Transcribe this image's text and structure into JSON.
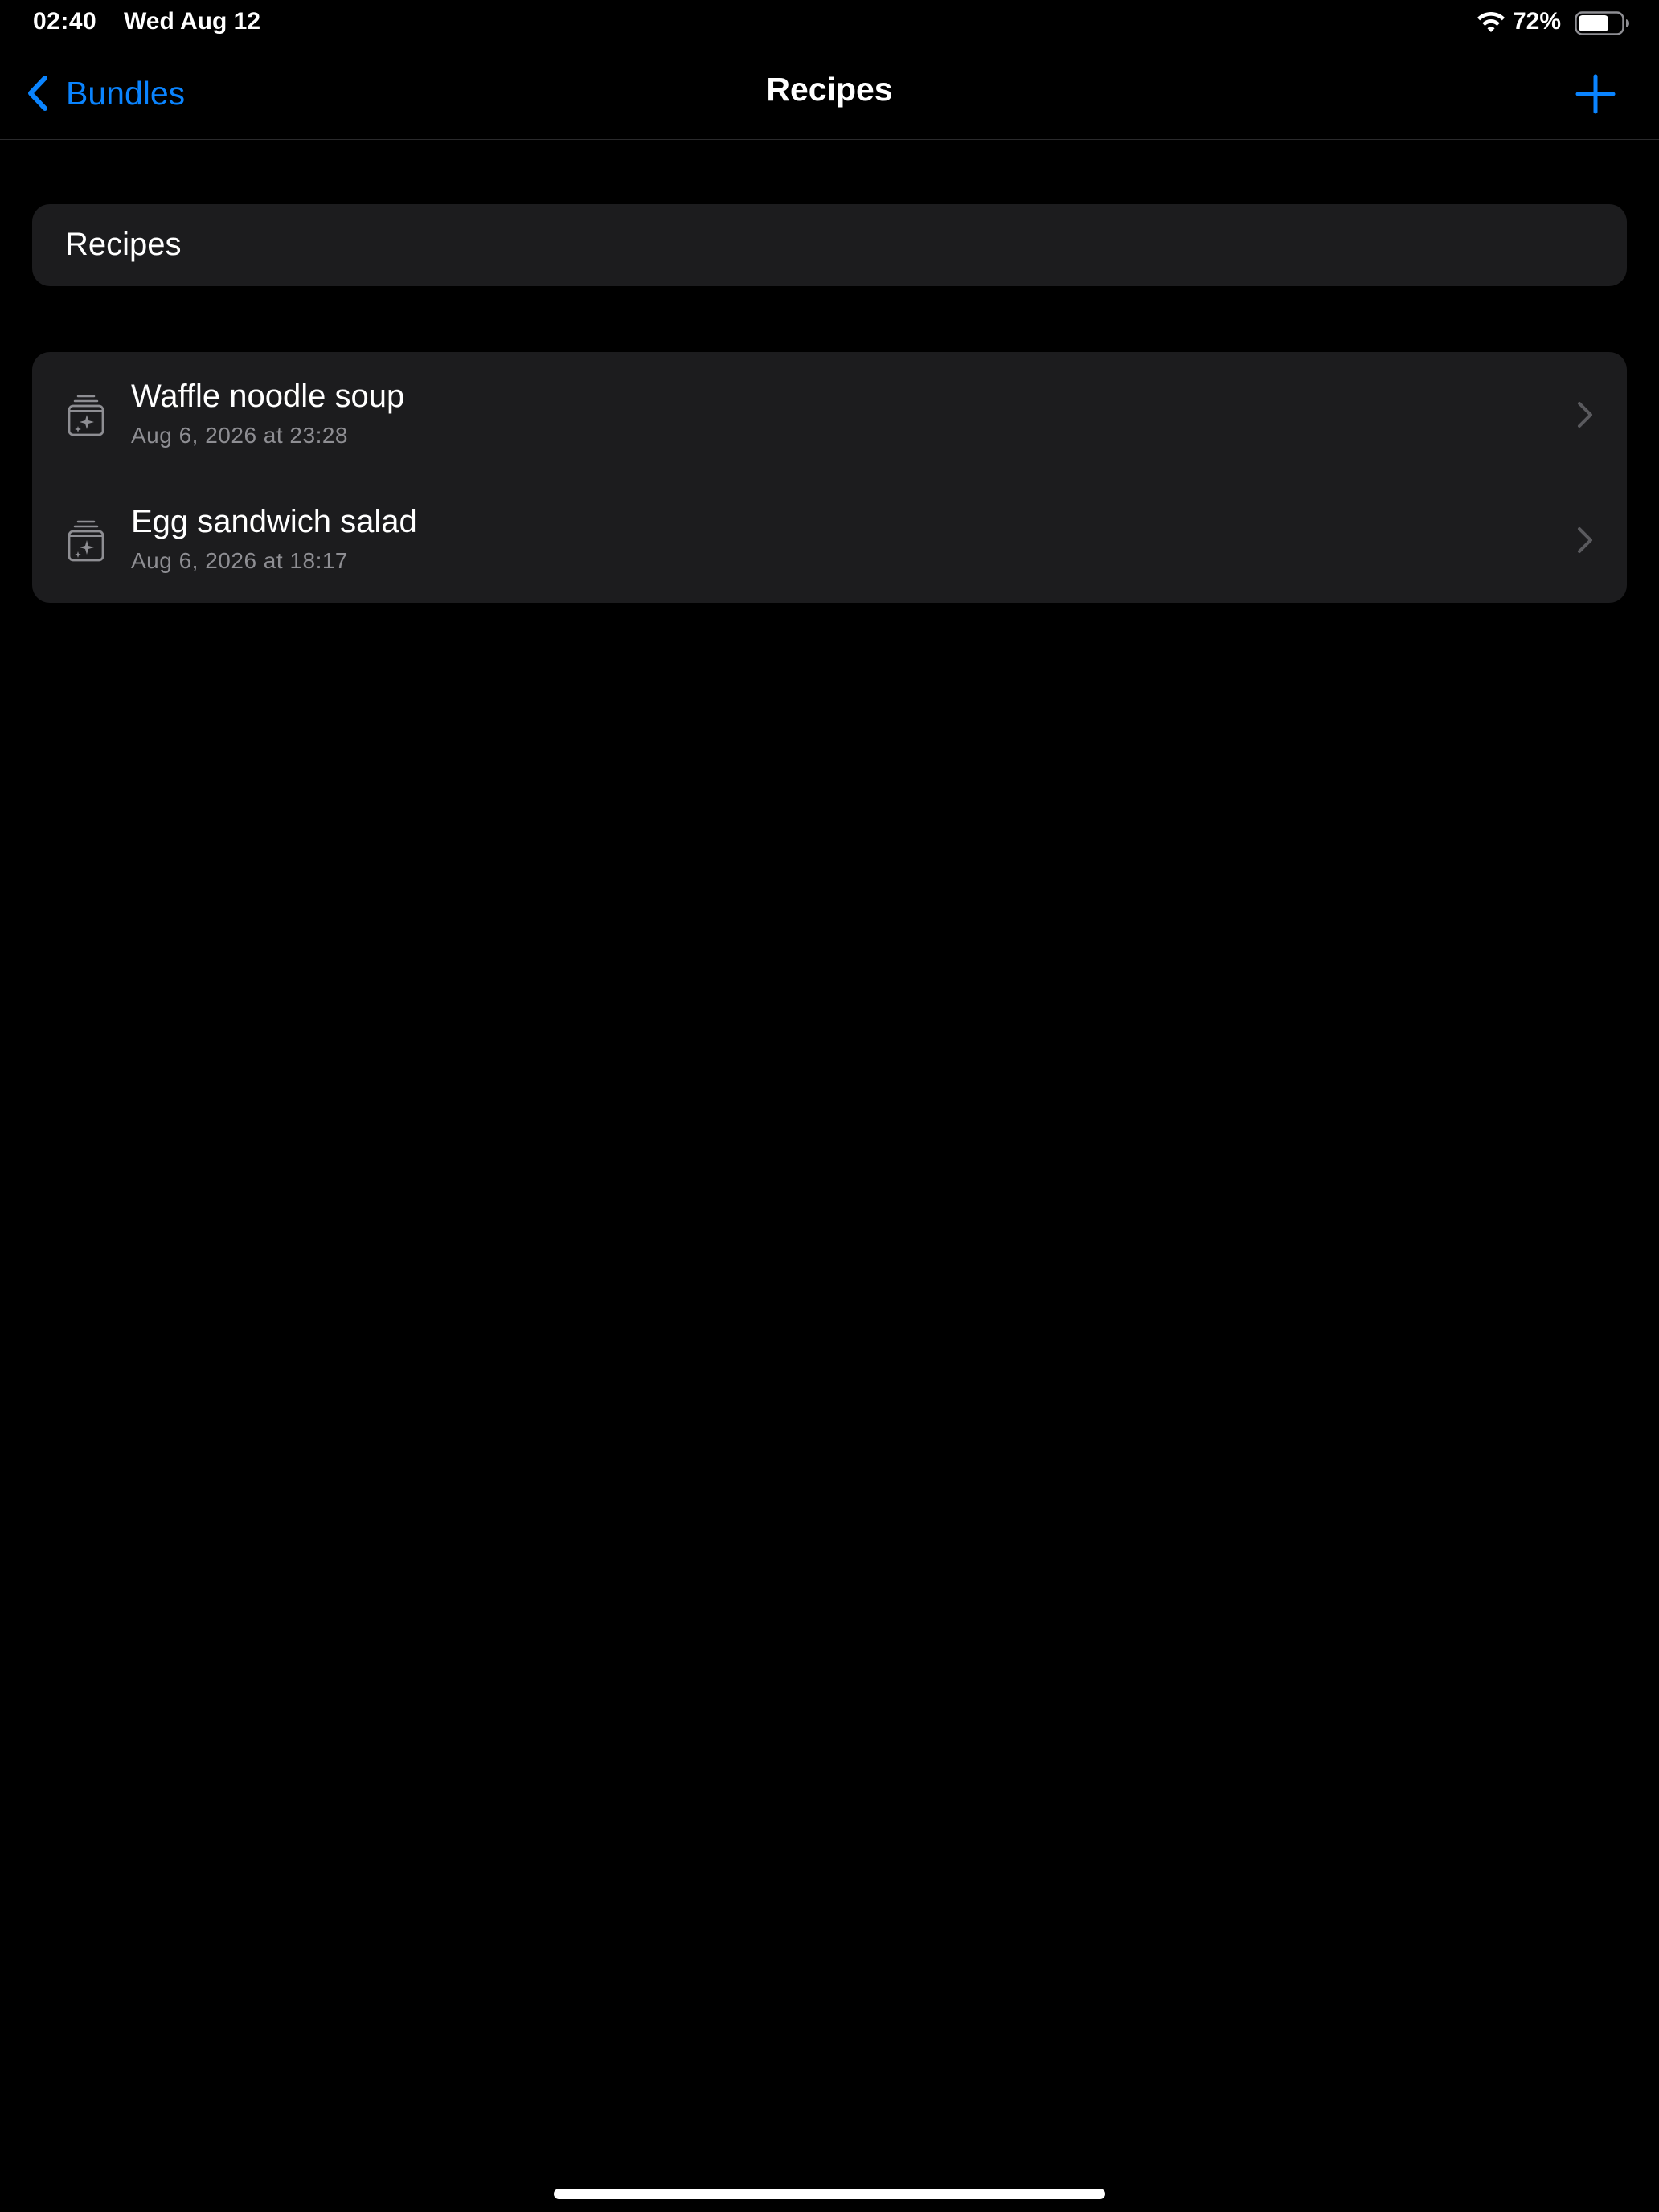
{
  "status_bar": {
    "time": "02:40",
    "date": "Wed Aug 12",
    "battery_percent": "72%",
    "battery_level": 0.72,
    "icons": [
      "wifi-icon",
      "battery-icon"
    ]
  },
  "nav": {
    "back_label": "Bundles",
    "title": "Recipes",
    "add_icon": "plus-icon"
  },
  "header_card": {
    "label": "Recipes"
  },
  "recipes": [
    {
      "title": "Waffle noodle soup",
      "subtitle": "Aug 6, 2026 at 23:28",
      "icon": "recipe-bundle-icon"
    },
    {
      "title": "Egg sandwich salad",
      "subtitle": "Aug 6, 2026 at 18:17",
      "icon": "recipe-bundle-icon"
    }
  ],
  "colors": {
    "background": "#000000",
    "card": "#1c1c1e",
    "accent": "#0a84ff",
    "secondary_text": "#8e8e93",
    "separator": "#38383a"
  }
}
